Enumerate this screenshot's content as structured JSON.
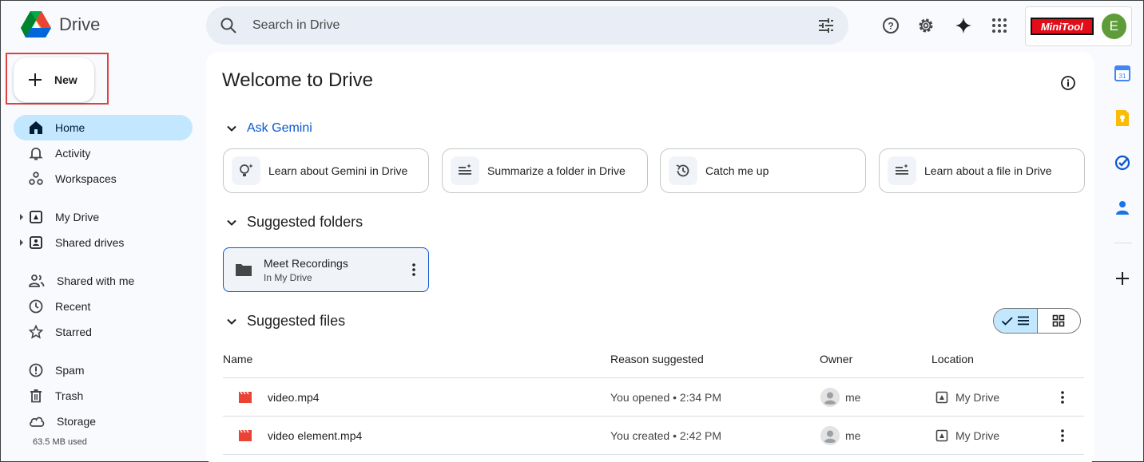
{
  "app": {
    "name": "Drive"
  },
  "search": {
    "placeholder": "Search in Drive"
  },
  "account": {
    "brand": "MiniTool",
    "avatar_letter": "E",
    "avatar_color": "#5e9c3a"
  },
  "new_button": {
    "label": "New"
  },
  "sidebar": {
    "items": [
      {
        "label": "Home",
        "icon": "home-icon",
        "active": true
      },
      {
        "label": "Activity",
        "icon": "bell-icon"
      },
      {
        "label": "Workspaces",
        "icon": "workspaces-icon"
      },
      {
        "label": "My Drive",
        "icon": "my-drive-icon"
      },
      {
        "label": "Shared drives",
        "icon": "shared-drives-icon"
      },
      {
        "label": "Shared with me",
        "icon": "people-icon"
      },
      {
        "label": "Recent",
        "icon": "clock-icon"
      },
      {
        "label": "Starred",
        "icon": "star-icon"
      },
      {
        "label": "Spam",
        "icon": "spam-icon"
      },
      {
        "label": "Trash",
        "icon": "trash-icon"
      },
      {
        "label": "Storage",
        "icon": "cloud-icon"
      }
    ],
    "storage_used": "63.5 MB used"
  },
  "main": {
    "title": "Welcome to Drive",
    "gemini": {
      "heading": "Ask Gemini",
      "cards": [
        {
          "label": "Learn about Gemini in Drive",
          "icon": "lightbulb-sparkle-icon"
        },
        {
          "label": "Summarize a folder in Drive",
          "icon": "list-sparkle-icon"
        },
        {
          "label": "Catch me up",
          "icon": "history-icon"
        },
        {
          "label": "Learn about a file in Drive",
          "icon": "list-sparkle-icon"
        }
      ]
    },
    "suggested_folders": {
      "heading": "Suggested folders",
      "folders": [
        {
          "name": "Meet Recordings",
          "location": "In My Drive"
        }
      ]
    },
    "suggested_files": {
      "heading": "Suggested files",
      "columns": [
        "Name",
        "Reason suggested",
        "Owner",
        "Location"
      ],
      "rows": [
        {
          "name": "video.mp4",
          "reason": "You opened • 2:34 PM",
          "owner": "me",
          "location": "My Drive"
        },
        {
          "name": "video element.mp4",
          "reason": "You created • 2:42 PM",
          "owner": "me",
          "location": "My Drive"
        }
      ]
    }
  },
  "colors": {
    "accent": "#0b57d0",
    "active_nav": "#c2e7ff",
    "video_icon": "#ea4335"
  }
}
